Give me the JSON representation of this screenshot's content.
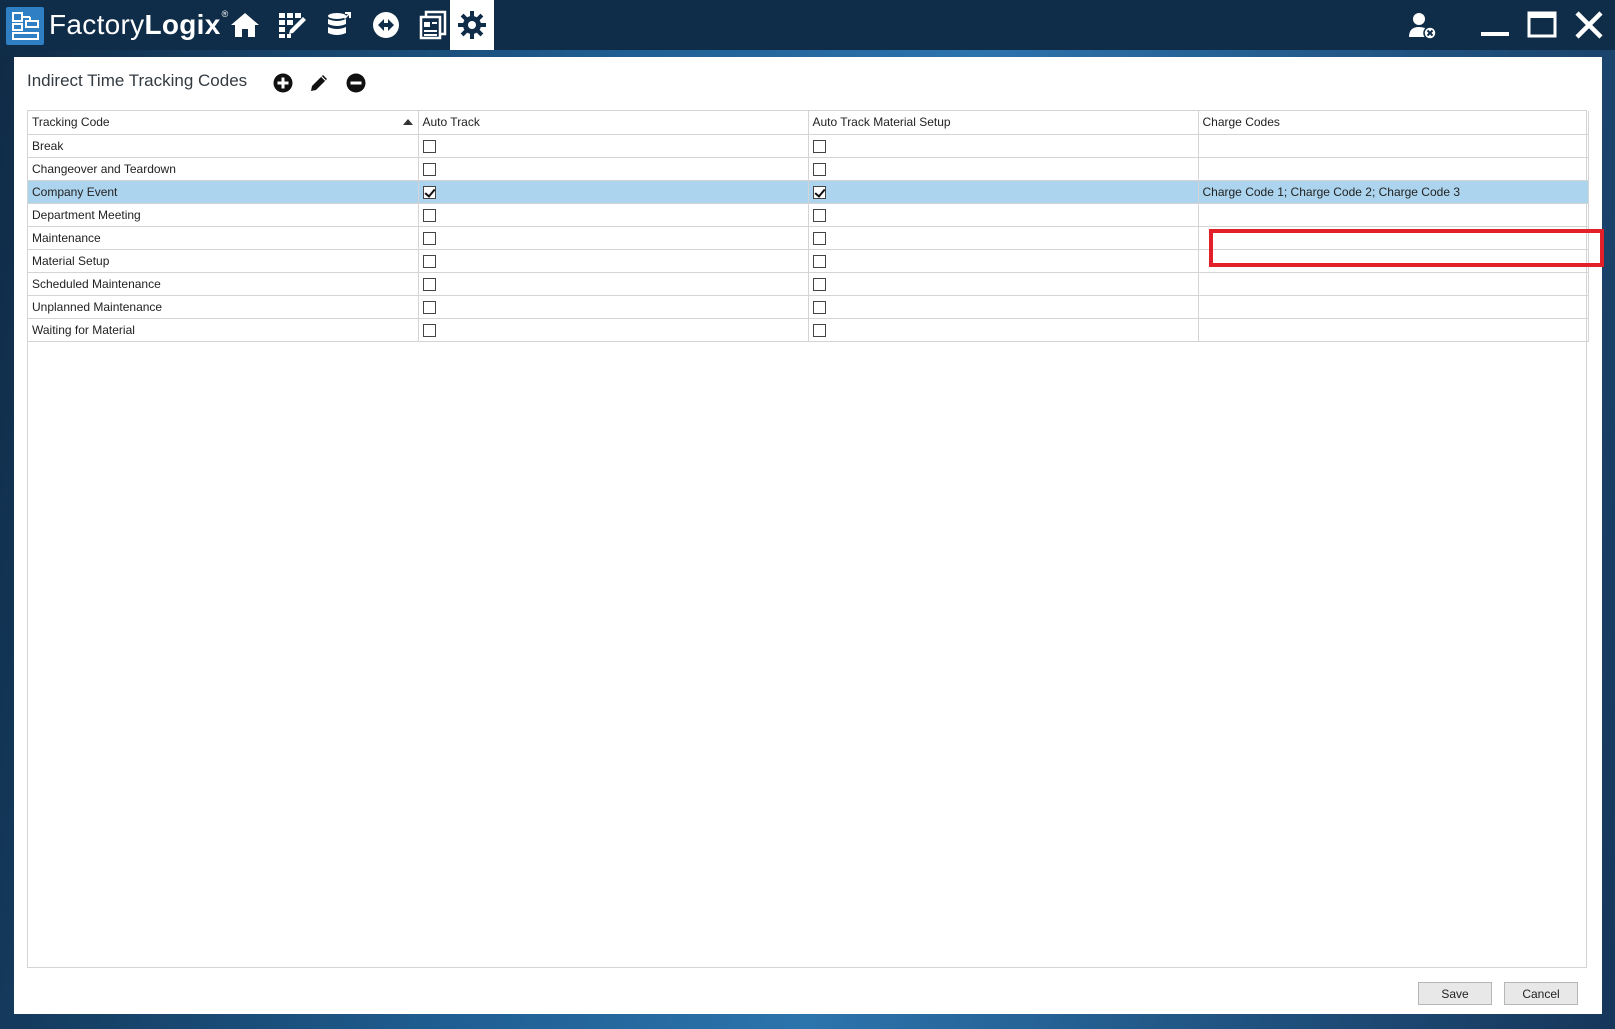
{
  "app": {
    "name_light": "Factory",
    "name_bold": "Logix",
    "trademark": "®"
  },
  "nav": [
    {
      "id": "home",
      "icon": "home-icon",
      "active": false
    },
    {
      "id": "engineering",
      "icon": "grid-edit-icon",
      "active": false
    },
    {
      "id": "database",
      "icon": "database-icon",
      "active": false
    },
    {
      "id": "navigator",
      "icon": "navigation-icon",
      "active": false
    },
    {
      "id": "reports",
      "icon": "documents-icon",
      "active": false
    },
    {
      "id": "settings",
      "icon": "gear-icon",
      "active": true
    }
  ],
  "page": {
    "title": "Indirect Time Tracking Codes"
  },
  "table": {
    "columns": [
      "Tracking Code",
      "Auto Track",
      "Auto Track Material Setup",
      "Charge Codes"
    ],
    "sort": {
      "column": "Tracking Code",
      "direction": "ascending"
    },
    "rows": [
      {
        "code": "Break",
        "auto_track": false,
        "auto_track_material_setup": false,
        "charge_codes": "",
        "selected": false
      },
      {
        "code": "Changeover and Teardown",
        "auto_track": false,
        "auto_track_material_setup": false,
        "charge_codes": "",
        "selected": false
      },
      {
        "code": "Company Event",
        "auto_track": true,
        "auto_track_material_setup": true,
        "charge_codes": "Charge Code 1; Charge Code 2; Charge Code 3",
        "selected": true
      },
      {
        "code": "Department Meeting",
        "auto_track": false,
        "auto_track_material_setup": false,
        "charge_codes": "",
        "selected": false
      },
      {
        "code": "Maintenance",
        "auto_track": false,
        "auto_track_material_setup": false,
        "charge_codes": "",
        "selected": false
      },
      {
        "code": "Material Setup",
        "auto_track": false,
        "auto_track_material_setup": false,
        "charge_codes": "",
        "selected": false
      },
      {
        "code": "Scheduled Maintenance",
        "auto_track": false,
        "auto_track_material_setup": false,
        "charge_codes": "",
        "selected": false
      },
      {
        "code": "Unplanned Maintenance",
        "auto_track": false,
        "auto_track_material_setup": false,
        "charge_codes": "",
        "selected": false
      },
      {
        "code": "Waiting for Material",
        "auto_track": false,
        "auto_track_material_setup": false,
        "charge_codes": "",
        "selected": false
      }
    ]
  },
  "footer": {
    "save_label": "Save",
    "cancel_label": "Cancel"
  },
  "colors": {
    "titlebar": "#0f2d48",
    "selected_row": "#add4ee",
    "highlight": "#e2202a",
    "logo": "#2f7fc4"
  }
}
